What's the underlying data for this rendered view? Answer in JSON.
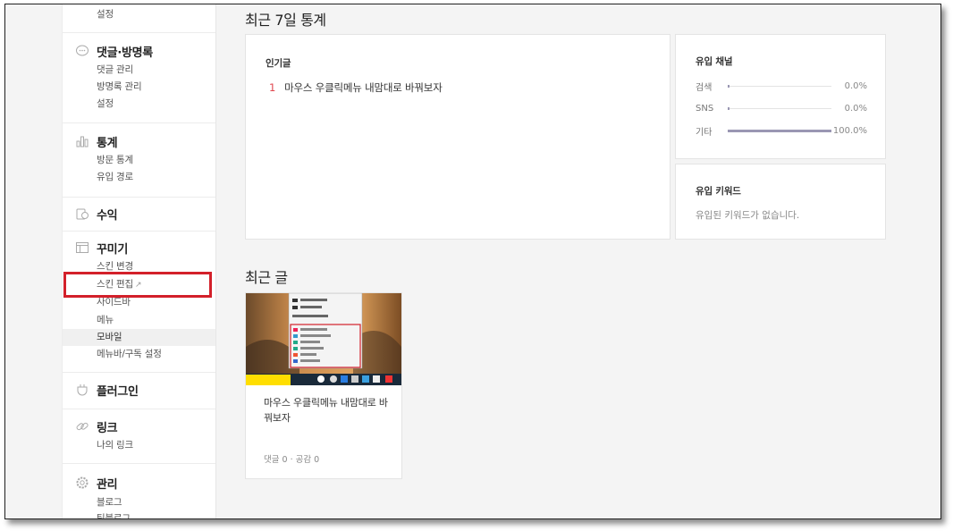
{
  "sidebar": {
    "top_item": "설정",
    "groups": [
      {
        "key": "comments",
        "icon": "speech-bubble-icon",
        "title": "댓글·방명록",
        "items": [
          "댓글 관리",
          "방명록 관리",
          "설정"
        ]
      },
      {
        "key": "stats",
        "icon": "bar-chart-icon",
        "title": "통계",
        "items": [
          "방문 통계",
          "유입 경로"
        ]
      },
      {
        "key": "revenue",
        "icon": "coins-icon",
        "title": "수익",
        "items": []
      },
      {
        "key": "decorate",
        "icon": "layout-icon",
        "title": "꾸미기",
        "items": [
          "스킨 변경",
          "스킨 편집",
          "사이드바",
          "메뉴",
          "모바일",
          "메뉴바/구독 설정"
        ]
      },
      {
        "key": "plugins",
        "icon": "plug-icon",
        "title": "플러그인",
        "items": []
      },
      {
        "key": "links",
        "icon": "link-icon",
        "title": "링크",
        "items": [
          "나의 링크"
        ]
      },
      {
        "key": "manage",
        "icon": "gear-icon",
        "title": "관리",
        "items": [
          "블로그",
          "팀블로그"
        ]
      }
    ],
    "skin_edit_external_glyph": "↗",
    "active_item": "모바일"
  },
  "stats": {
    "title": "최근 7일 통계",
    "popular": {
      "title": "인기글",
      "items": [
        {
          "rank": "1",
          "text": "마우스 우클릭메뉴 내맘대로 바꿔보자"
        }
      ]
    },
    "channels": {
      "title": "유입 채널",
      "rows": [
        {
          "label": "검색",
          "pct": "0.0%",
          "value": 0
        },
        {
          "label": "SNS",
          "pct": "0.0%",
          "value": 0
        },
        {
          "label": "기타",
          "pct": "100.0%",
          "value": 100
        }
      ]
    },
    "keywords": {
      "title": "유입 키워드",
      "empty": "유입된 키워드가 없습니다."
    }
  },
  "recent": {
    "title": "최근 글",
    "posts": [
      {
        "title": "마우스 우클릭메뉴 내맘대로 바꿔보자",
        "comments_label": "댓글 0",
        "likes_label": "공감 0",
        "separator": "·"
      }
    ]
  },
  "colors": {
    "highlight_box": "#d3202a",
    "rank": "#e0464e",
    "channel_fill": "#9a97b3"
  }
}
